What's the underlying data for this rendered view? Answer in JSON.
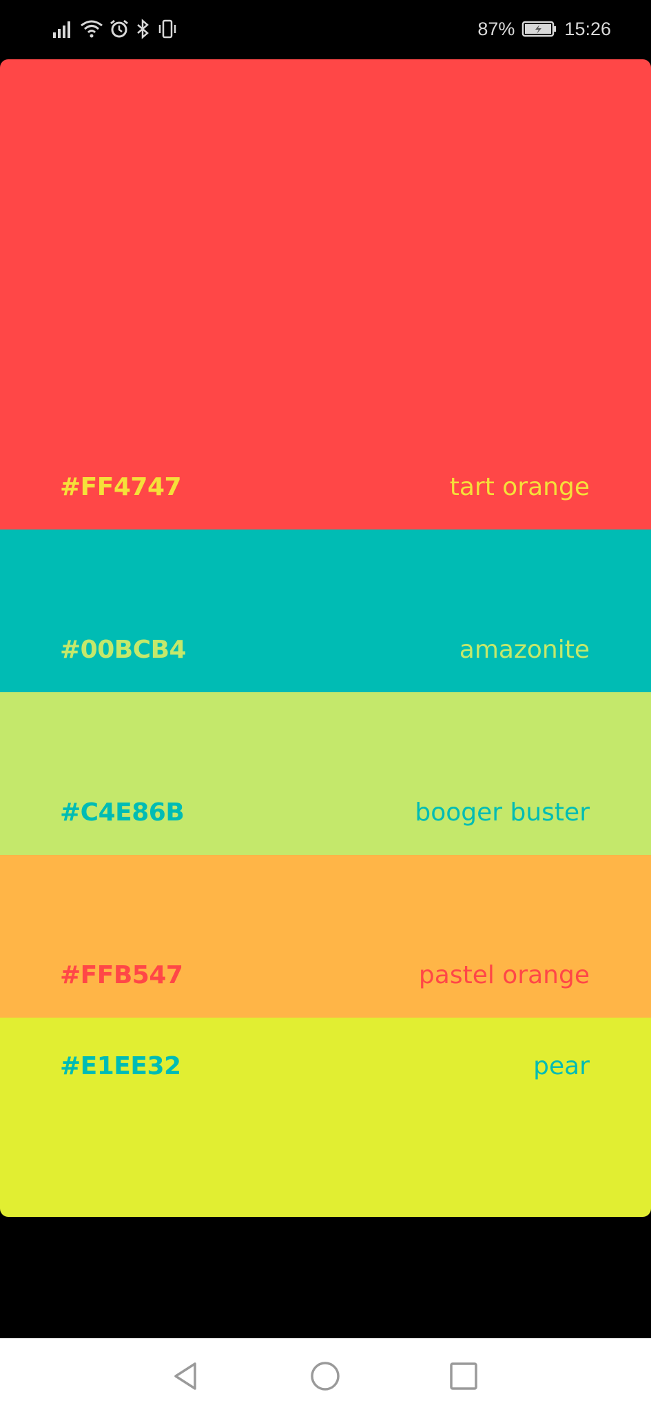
{
  "status_bar": {
    "battery": "87%",
    "time": "15:26",
    "icons": [
      "signal-icon",
      "wifi-icon",
      "alarm-icon",
      "bluetooth-icon",
      "vibrate-icon",
      "battery-icon"
    ]
  },
  "palette": {
    "swatches": [
      {
        "hex": "#FF4747",
        "name": "tart orange",
        "bg": "#ff4747",
        "text_color": "#f5e03a"
      },
      {
        "hex": "#00BCB4",
        "name": "amazonite",
        "bg": "#00bcb4",
        "text_color": "#c4e86b"
      },
      {
        "hex": "#C4E86B",
        "name": "booger buster",
        "bg": "#c4e86b",
        "text_color": "#00bcb4"
      },
      {
        "hex": "#FFB547",
        "name": "pastel orange",
        "bg": "#ffb547",
        "text_color": "#ff4747"
      },
      {
        "hex": "#E1EE32",
        "name": "pear",
        "bg": "#e1ee32",
        "text_color": "#00bcb4"
      }
    ]
  },
  "nav_bar": {
    "buttons": [
      "back-icon",
      "home-icon",
      "recents-icon"
    ]
  }
}
